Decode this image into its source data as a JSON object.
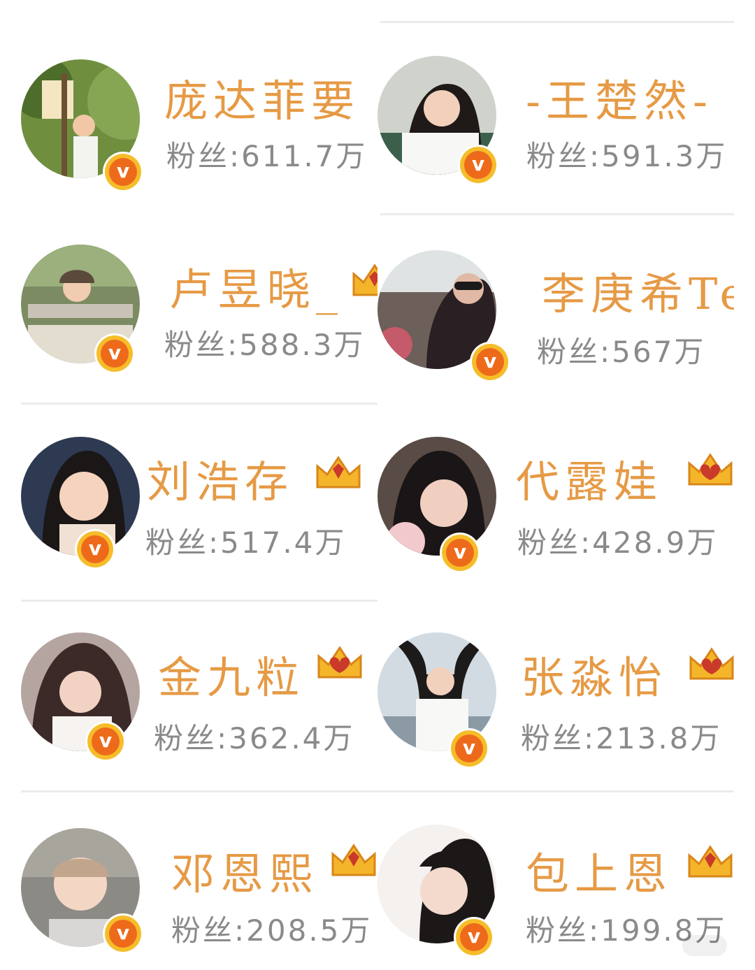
{
  "fans_label": "粉丝:",
  "badge_letter": "v",
  "crown_icon": "crown-badge-icon",
  "verified_icon": "verified-v-icon",
  "colors": {
    "name": "#e69a45",
    "fans": "#8a8a8a",
    "badge_outer": "#f6bd2a",
    "badge_inner": "#ee6a1b",
    "divider": "#ececec"
  },
  "accounts": [
    {
      "name": "庞达菲要",
      "fans": "611.7万"
    },
    {
      "name": "-王楚然-",
      "fans": "591.3万"
    },
    {
      "name": "卢昱晓_",
      "fans": "588.3万"
    },
    {
      "name": "李庚希Te",
      "fans": "567万"
    },
    {
      "name": "刘浩存",
      "fans": "517.4万"
    },
    {
      "name": "代露娃",
      "fans": "428.9万"
    },
    {
      "name": "金九粒",
      "fans": "362.4万"
    },
    {
      "name": "张淼怡",
      "fans": "213.8万"
    },
    {
      "name": "邓恩熙",
      "fans": "208.5万"
    },
    {
      "name": "包上恩",
      "fans": "199.8万"
    }
  ]
}
